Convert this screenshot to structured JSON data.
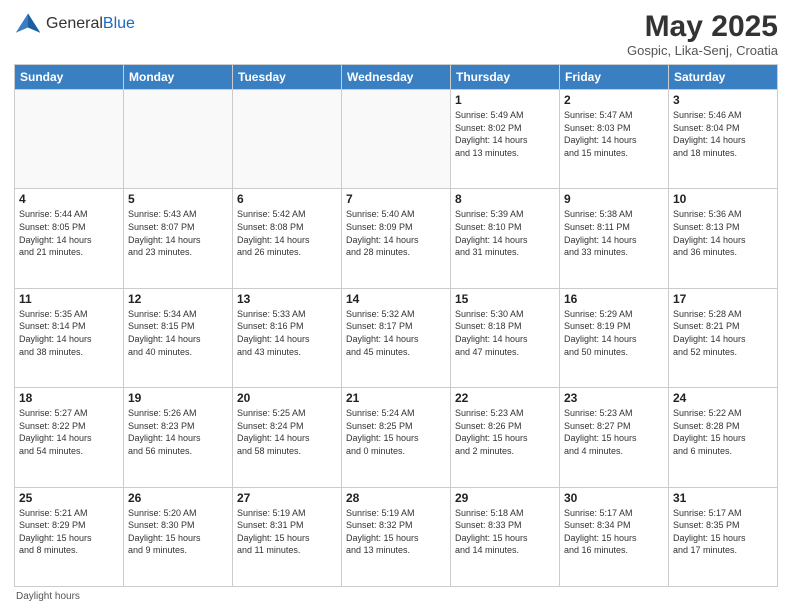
{
  "header": {
    "logo_general": "General",
    "logo_blue": "Blue",
    "month_title": "May 2025",
    "subtitle": "Gospic, Lika-Senj, Croatia"
  },
  "days_of_week": [
    "Sunday",
    "Monday",
    "Tuesday",
    "Wednesday",
    "Thursday",
    "Friday",
    "Saturday"
  ],
  "weeks": [
    [
      {
        "day": "",
        "info": ""
      },
      {
        "day": "",
        "info": ""
      },
      {
        "day": "",
        "info": ""
      },
      {
        "day": "",
        "info": ""
      },
      {
        "day": "1",
        "info": "Sunrise: 5:49 AM\nSunset: 8:02 PM\nDaylight: 14 hours\nand 13 minutes."
      },
      {
        "day": "2",
        "info": "Sunrise: 5:47 AM\nSunset: 8:03 PM\nDaylight: 14 hours\nand 15 minutes."
      },
      {
        "day": "3",
        "info": "Sunrise: 5:46 AM\nSunset: 8:04 PM\nDaylight: 14 hours\nand 18 minutes."
      }
    ],
    [
      {
        "day": "4",
        "info": "Sunrise: 5:44 AM\nSunset: 8:05 PM\nDaylight: 14 hours\nand 21 minutes."
      },
      {
        "day": "5",
        "info": "Sunrise: 5:43 AM\nSunset: 8:07 PM\nDaylight: 14 hours\nand 23 minutes."
      },
      {
        "day": "6",
        "info": "Sunrise: 5:42 AM\nSunset: 8:08 PM\nDaylight: 14 hours\nand 26 minutes."
      },
      {
        "day": "7",
        "info": "Sunrise: 5:40 AM\nSunset: 8:09 PM\nDaylight: 14 hours\nand 28 minutes."
      },
      {
        "day": "8",
        "info": "Sunrise: 5:39 AM\nSunset: 8:10 PM\nDaylight: 14 hours\nand 31 minutes."
      },
      {
        "day": "9",
        "info": "Sunrise: 5:38 AM\nSunset: 8:11 PM\nDaylight: 14 hours\nand 33 minutes."
      },
      {
        "day": "10",
        "info": "Sunrise: 5:36 AM\nSunset: 8:13 PM\nDaylight: 14 hours\nand 36 minutes."
      }
    ],
    [
      {
        "day": "11",
        "info": "Sunrise: 5:35 AM\nSunset: 8:14 PM\nDaylight: 14 hours\nand 38 minutes."
      },
      {
        "day": "12",
        "info": "Sunrise: 5:34 AM\nSunset: 8:15 PM\nDaylight: 14 hours\nand 40 minutes."
      },
      {
        "day": "13",
        "info": "Sunrise: 5:33 AM\nSunset: 8:16 PM\nDaylight: 14 hours\nand 43 minutes."
      },
      {
        "day": "14",
        "info": "Sunrise: 5:32 AM\nSunset: 8:17 PM\nDaylight: 14 hours\nand 45 minutes."
      },
      {
        "day": "15",
        "info": "Sunrise: 5:30 AM\nSunset: 8:18 PM\nDaylight: 14 hours\nand 47 minutes."
      },
      {
        "day": "16",
        "info": "Sunrise: 5:29 AM\nSunset: 8:19 PM\nDaylight: 14 hours\nand 50 minutes."
      },
      {
        "day": "17",
        "info": "Sunrise: 5:28 AM\nSunset: 8:21 PM\nDaylight: 14 hours\nand 52 minutes."
      }
    ],
    [
      {
        "day": "18",
        "info": "Sunrise: 5:27 AM\nSunset: 8:22 PM\nDaylight: 14 hours\nand 54 minutes."
      },
      {
        "day": "19",
        "info": "Sunrise: 5:26 AM\nSunset: 8:23 PM\nDaylight: 14 hours\nand 56 minutes."
      },
      {
        "day": "20",
        "info": "Sunrise: 5:25 AM\nSunset: 8:24 PM\nDaylight: 14 hours\nand 58 minutes."
      },
      {
        "day": "21",
        "info": "Sunrise: 5:24 AM\nSunset: 8:25 PM\nDaylight: 15 hours\nand 0 minutes."
      },
      {
        "day": "22",
        "info": "Sunrise: 5:23 AM\nSunset: 8:26 PM\nDaylight: 15 hours\nand 2 minutes."
      },
      {
        "day": "23",
        "info": "Sunrise: 5:23 AM\nSunset: 8:27 PM\nDaylight: 15 hours\nand 4 minutes."
      },
      {
        "day": "24",
        "info": "Sunrise: 5:22 AM\nSunset: 8:28 PM\nDaylight: 15 hours\nand 6 minutes."
      }
    ],
    [
      {
        "day": "25",
        "info": "Sunrise: 5:21 AM\nSunset: 8:29 PM\nDaylight: 15 hours\nand 8 minutes."
      },
      {
        "day": "26",
        "info": "Sunrise: 5:20 AM\nSunset: 8:30 PM\nDaylight: 15 hours\nand 9 minutes."
      },
      {
        "day": "27",
        "info": "Sunrise: 5:19 AM\nSunset: 8:31 PM\nDaylight: 15 hours\nand 11 minutes."
      },
      {
        "day": "28",
        "info": "Sunrise: 5:19 AM\nSunset: 8:32 PM\nDaylight: 15 hours\nand 13 minutes."
      },
      {
        "day": "29",
        "info": "Sunrise: 5:18 AM\nSunset: 8:33 PM\nDaylight: 15 hours\nand 14 minutes."
      },
      {
        "day": "30",
        "info": "Sunrise: 5:17 AM\nSunset: 8:34 PM\nDaylight: 15 hours\nand 16 minutes."
      },
      {
        "day": "31",
        "info": "Sunrise: 5:17 AM\nSunset: 8:35 PM\nDaylight: 15 hours\nand 17 minutes."
      }
    ]
  ],
  "footer": "Daylight hours"
}
